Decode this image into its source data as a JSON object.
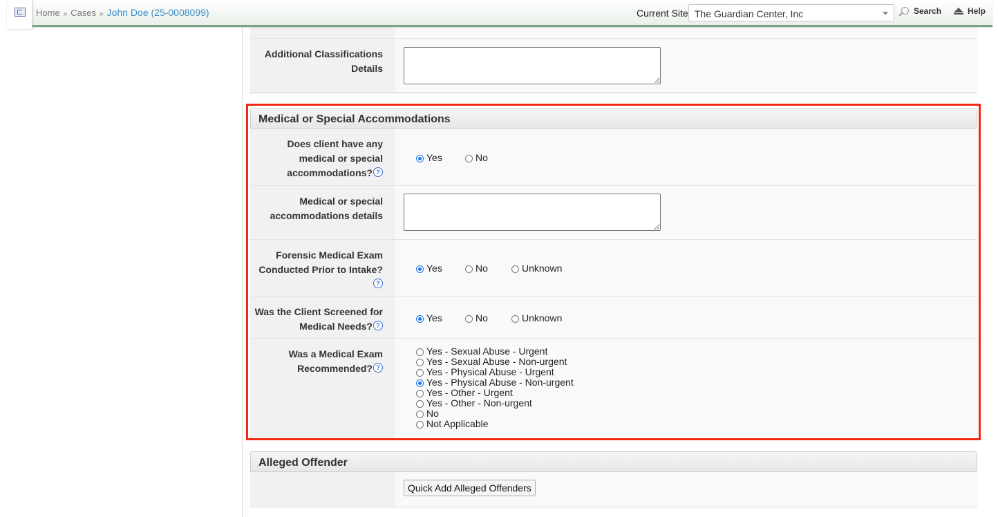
{
  "header": {
    "breadcrumbs": [
      "Home",
      "Cases"
    ],
    "breadcrumb_separator": "»",
    "current": "John Doe (25-0008099)",
    "current_site_label": "Current Site",
    "current_site_value": "The Guardian Center, Inc",
    "search_label": "Search",
    "help_label": "Help"
  },
  "prior_section": {
    "additional_classifications_label": "Additional Classifications Details",
    "additional_classifications_value": ""
  },
  "medical_section": {
    "title": "Medical or Special Accommodations",
    "q1": {
      "label": "Does client have any medical or special accommodations?",
      "options": [
        "Yes",
        "No"
      ],
      "selected": "Yes"
    },
    "details": {
      "label": "Medical or special accommodations details",
      "value": ""
    },
    "q2": {
      "label": "Forensic Medical Exam Conducted Prior to Intake?",
      "options": [
        "Yes",
        "No",
        "Unknown"
      ],
      "selected": "Yes"
    },
    "q3": {
      "label": "Was the Client Screened for Medical Needs?",
      "options": [
        "Yes",
        "No",
        "Unknown"
      ],
      "selected": "Yes"
    },
    "q4": {
      "label": "Was a Medical Exam Recommended?",
      "options": [
        "Yes - Sexual Abuse - Urgent",
        "Yes - Sexual Abuse - Non-urgent",
        "Yes - Physical Abuse - Urgent",
        "Yes - Physical Abuse - Non-urgent",
        "Yes - Other - Urgent",
        "Yes - Other - Non-urgent",
        "No",
        "Not Applicable"
      ],
      "selected": "Yes - Physical Abuse - Non-urgent"
    }
  },
  "offender_section": {
    "title": "Alleged Offender",
    "quick_add_label": "Quick Add Alleged Offenders"
  },
  "help_glyph": "?",
  "colors": {
    "accent": "#74a585",
    "highlight": "#f22a14",
    "link": "#3c8dc7",
    "radio_selected": "#1a73e8"
  }
}
